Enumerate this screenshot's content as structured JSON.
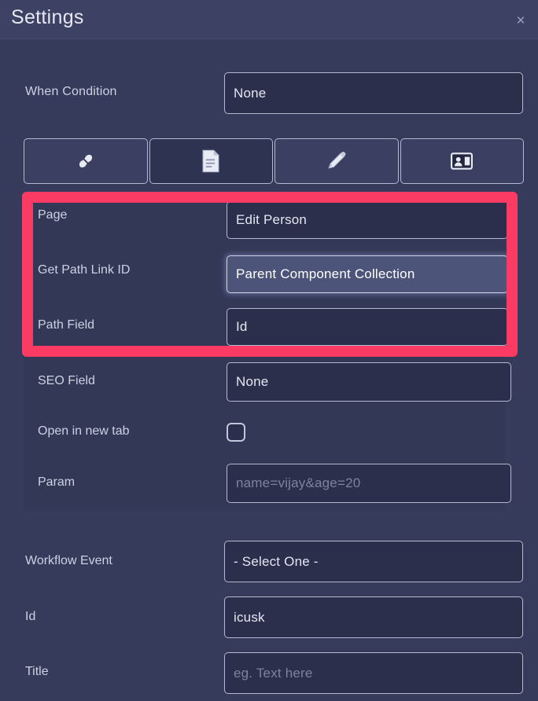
{
  "window": {
    "title": "Settings",
    "close_icon": "close-icon",
    "close_glyph": "×"
  },
  "top_section": {
    "when_condition": {
      "label": "When Condition",
      "value": "None"
    }
  },
  "tabs": [
    {
      "icon": "link-icon",
      "label": "Link",
      "active": false
    },
    {
      "icon": "document-icon",
      "label": "Page",
      "active": true
    },
    {
      "icon": "pencil-icon",
      "label": "Edit",
      "active": false
    },
    {
      "icon": "contact-card-icon",
      "label": "Contact",
      "active": false
    }
  ],
  "panel": {
    "page": {
      "label": "Page",
      "value": "Edit Person"
    },
    "get_path_link_id": {
      "label": "Get Path Link ID",
      "value": "Parent Component Collection",
      "focused": true
    },
    "path_field": {
      "label": "Path Field",
      "value": "Id"
    },
    "seo_field": {
      "label": "SEO Field",
      "value": "None"
    },
    "open_in_new_tab": {
      "label": "Open in new tab",
      "checked": false
    },
    "param": {
      "label": "Param",
      "value": "",
      "placeholder": "name=vijay&age=20"
    }
  },
  "bottom_section": {
    "workflow_event": {
      "label": "Workflow Event",
      "value": "- Select One -"
    },
    "id": {
      "label": "Id",
      "value": "icusk"
    },
    "title": {
      "label": "Title",
      "value": "",
      "placeholder": "eg. Text here"
    }
  },
  "annotation": {
    "highlight_color": "#fb3b64",
    "name": "highlight-rectangle"
  },
  "colors": {
    "window_bg": "#363b5c",
    "titlebar_bg": "#3d4163",
    "panel_bg": "#333857",
    "field_bg": "#2b2f4c",
    "field_border": "#b4b9d0",
    "focus_bg": "#4d5479",
    "text": "#e4e7f2",
    "placeholder_text": "#7d82a0",
    "accent_pink": "#fb3b64"
  }
}
